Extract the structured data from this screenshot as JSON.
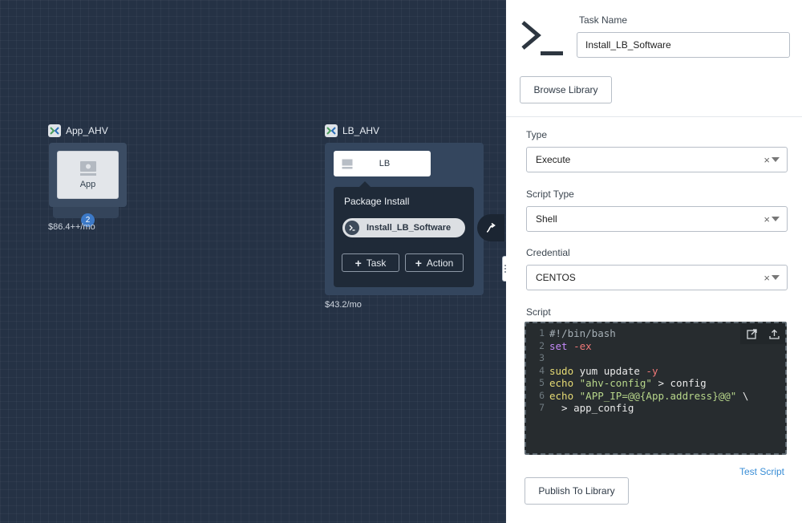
{
  "canvas": {
    "services": [
      {
        "name": "App_AHV",
        "card_label": "App",
        "count": "2",
        "cost": "$86.4++/mo"
      },
      {
        "name": "LB_AHV",
        "card_label": "LB",
        "cost": "$43.2/mo"
      }
    ],
    "package_panel": {
      "title": "Package Install",
      "task_name": "Install_LB_Software",
      "add_task_label": "Task",
      "add_action_label": "Action"
    }
  },
  "panel": {
    "task_name_label": "Task Name",
    "task_name_value": "Install_LB_Software",
    "browse_library_label": "Browse Library",
    "type_label": "Type",
    "type_value": "Execute",
    "script_type_label": "Script Type",
    "script_type_value": "Shell",
    "credential_label": "Credential",
    "credential_value": "CENTOS",
    "script_label": "Script",
    "script_lines": [
      {
        "n": "1",
        "text": "#!/bin/bash"
      },
      {
        "n": "2",
        "text": "set -ex"
      },
      {
        "n": "3",
        "text": ""
      },
      {
        "n": "4",
        "text": "sudo yum update -y"
      },
      {
        "n": "5",
        "text": "echo \"ahv-config\" > config"
      },
      {
        "n": "6",
        "text": "echo \"APP_IP=@@{App.address}@@\" \\"
      },
      {
        "n": "7",
        "text": "  > app_config"
      }
    ],
    "test_script_label": "Test Script",
    "publish_label": "Publish To Library"
  },
  "colors": {
    "accent_link": "#3a8ed6",
    "badge": "#3c79c7",
    "canvas_bg": "#253245"
  }
}
